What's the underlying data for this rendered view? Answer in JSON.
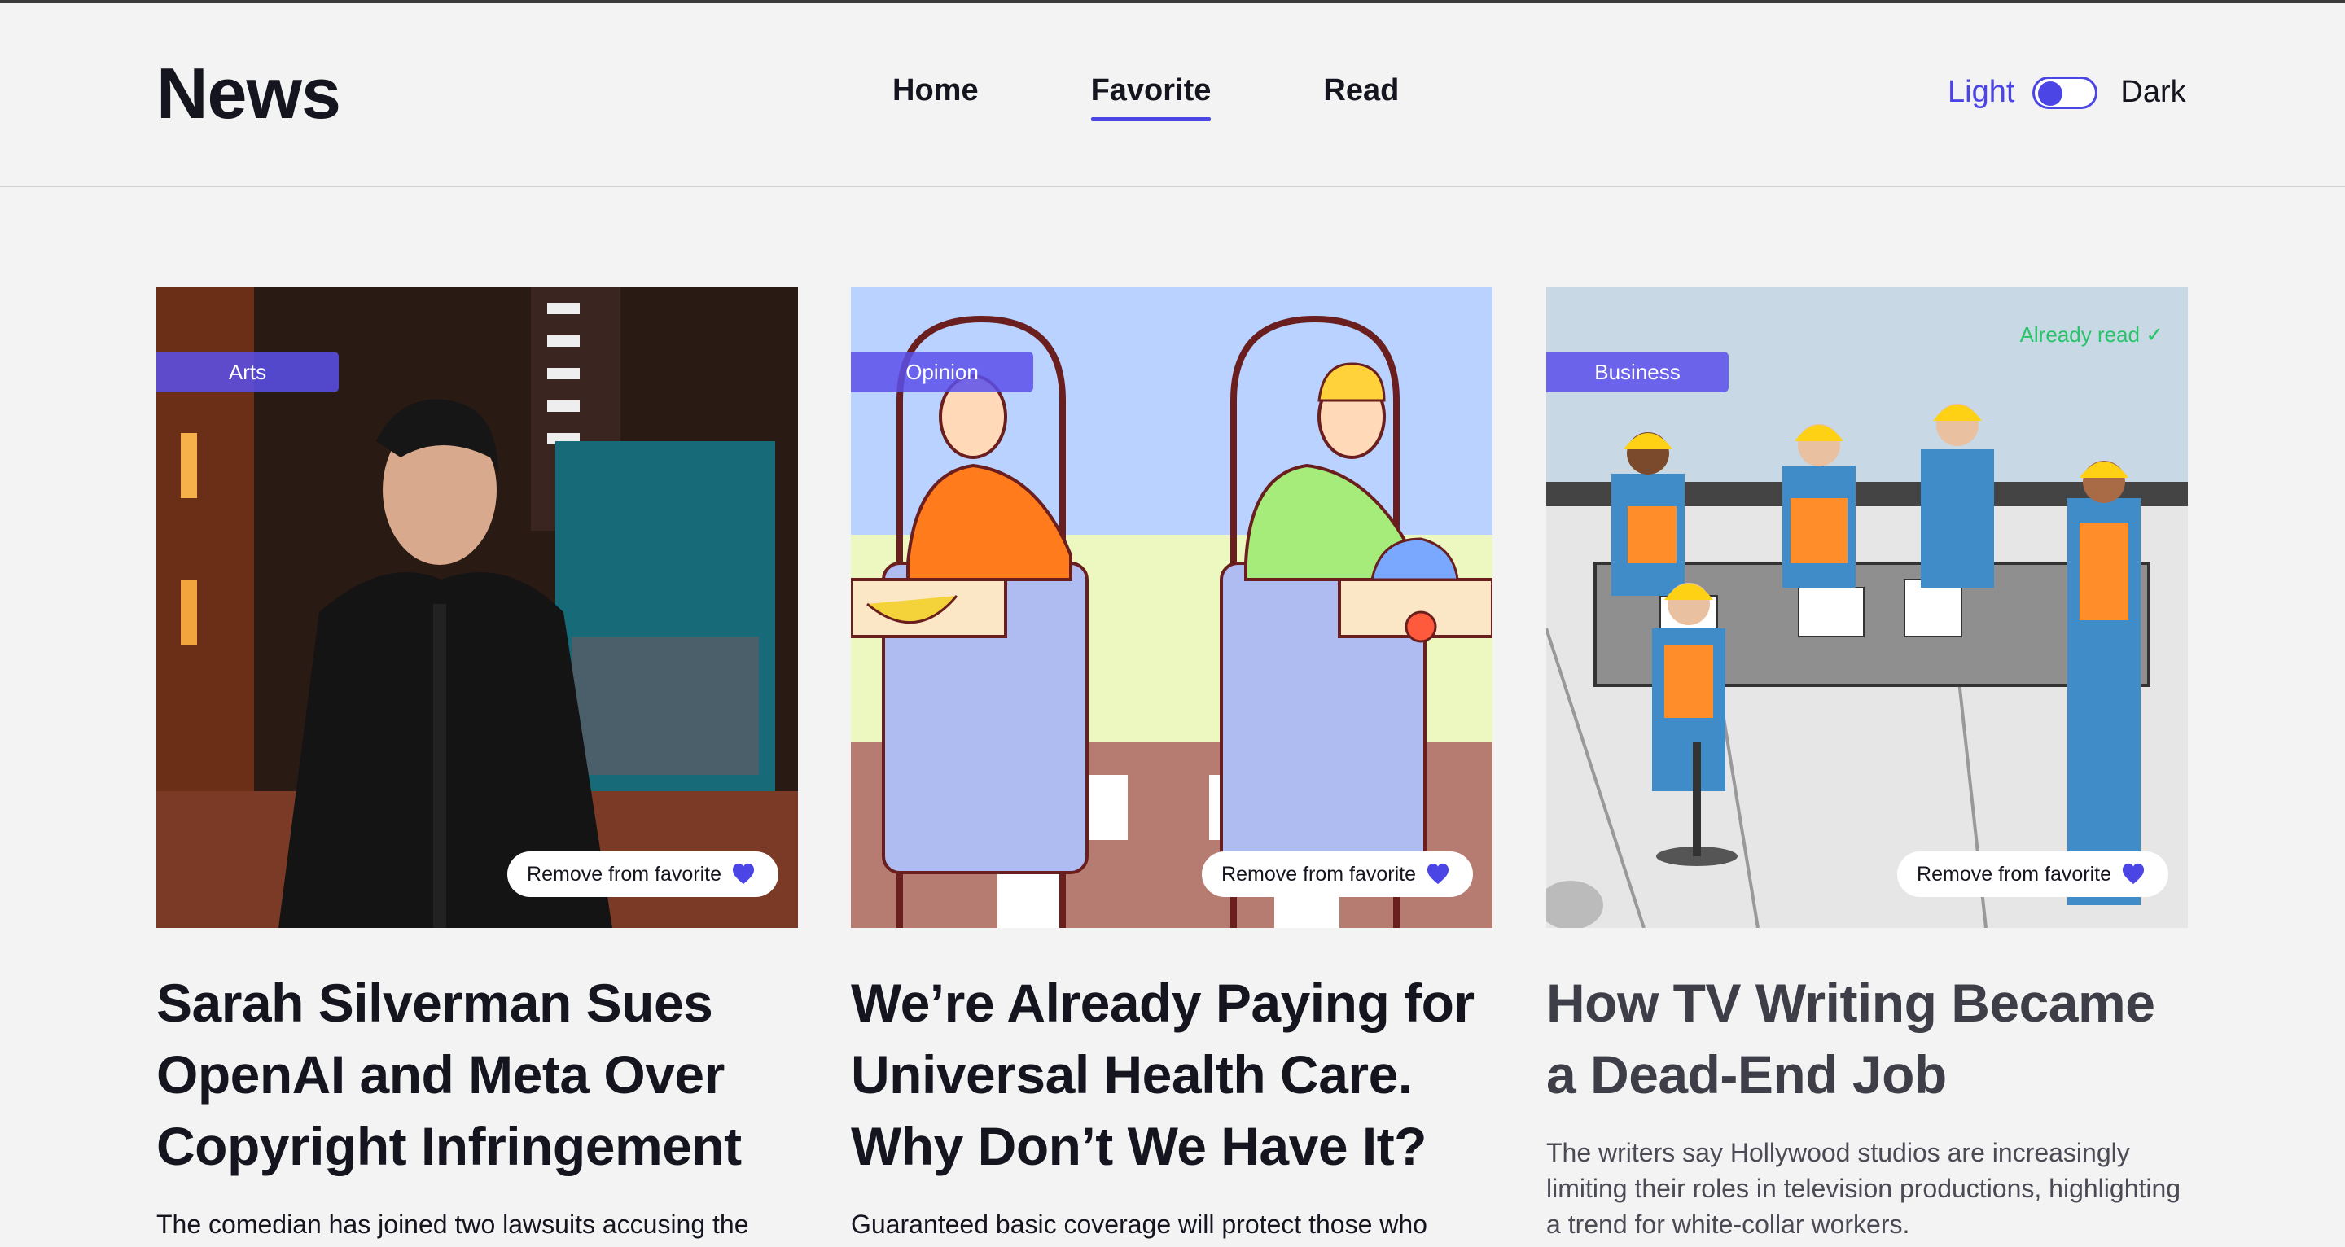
{
  "app": {
    "logo": "News"
  },
  "nav": {
    "items": [
      {
        "label": "Home"
      },
      {
        "label": "Favorite",
        "active": true
      },
      {
        "label": "Read"
      }
    ]
  },
  "theme": {
    "light_label": "Light",
    "dark_label": "Dark",
    "current": "Light"
  },
  "colors": {
    "accent": "#4b45e6",
    "read_indicator": "#27c46a",
    "background": "#f3f3f3"
  },
  "articles": [
    {
      "category": "Arts",
      "title": "Sarah Silverman Sues OpenAI and Meta Over Copyright Infringement",
      "description": "The comedian has joined two lawsuits accusing the",
      "favorite_button": "Remove from favorite",
      "read": false
    },
    {
      "category": "Opinion",
      "title": "We’re Already Paying for Universal Health Care. Why Don’t We Have It?",
      "description": "Guaranteed basic coverage will protect those who",
      "favorite_button": "Remove from favorite",
      "read": false
    },
    {
      "category": "Business",
      "title": "How TV Writing Became a Dead-End Job",
      "description": "The writers say Hollywood studios are increasingly limiting their roles in television productions, highlighting a trend for white-collar workers.",
      "favorite_button": "Remove from favorite",
      "read": true,
      "read_label": "Already read ✓"
    }
  ]
}
